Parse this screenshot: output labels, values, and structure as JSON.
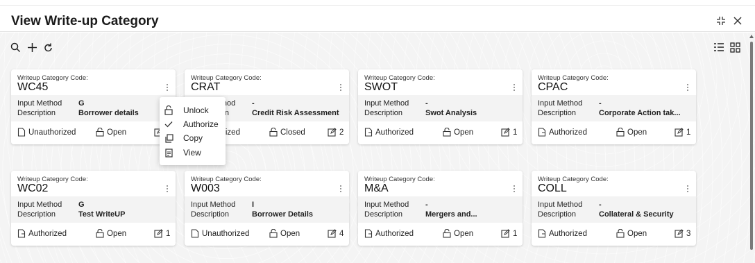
{
  "header": {
    "title": "View Write-up Category"
  },
  "toolbar": {},
  "cards": [
    {
      "code_label": "Writeup Category Code:",
      "code": "WC45",
      "input_method_label": "Input Method",
      "input_method": "G",
      "description_label": "Description",
      "description": "Borrower details",
      "status": "Unauthorized",
      "record": "Open",
      "versions": "1"
    },
    {
      "code_label": "Writeup Category Code:",
      "code": "CRAT",
      "input_method_label": "Input Method",
      "input_method": "-",
      "description_label": "Description",
      "description": "Credit Risk Assessment",
      "status": "Authorized",
      "record": "Closed",
      "versions": "2"
    },
    {
      "code_label": "Writeup Category Code:",
      "code": "SWOT",
      "input_method_label": "Input Method",
      "input_method": "-",
      "description_label": "Description",
      "description": "Swot Analysis",
      "status": "Authorized",
      "record": "Open",
      "versions": "1"
    },
    {
      "code_label": "Writeup Category Code:",
      "code": "CPAC",
      "input_method_label": "Input Method",
      "input_method": "-",
      "description_label": "Description",
      "description": "Corporate Action tak...",
      "status": "Authorized",
      "record": "Open",
      "versions": "1"
    },
    {
      "code_label": "Writeup Category Code:",
      "code": "WC02",
      "input_method_label": "Input Method",
      "input_method": "G",
      "description_label": "Description",
      "description": "Test WriteUP",
      "status": "Authorized",
      "record": "Open",
      "versions": "1"
    },
    {
      "code_label": "Writeup Category Code:",
      "code": "W003",
      "input_method_label": "Input Method",
      "input_method": "I",
      "description_label": "Description",
      "description": "Borrower Details",
      "status": "Unauthorized",
      "record": "Open",
      "versions": "4"
    },
    {
      "code_label": "Writeup Category Code:",
      "code": "M&A",
      "input_method_label": "Input Method",
      "input_method": "-",
      "description_label": "Description",
      "description": "Mergers and...",
      "status": "Authorized",
      "record": "Open",
      "versions": "1"
    },
    {
      "code_label": "Writeup Category Code:",
      "code": "COLL",
      "input_method_label": "Input Method",
      "input_method": "-",
      "description_label": "Description",
      "description": "Collateral & Security",
      "status": "Authorized",
      "record": "Open",
      "versions": "3"
    }
  ],
  "context_menu": {
    "unlock": "Unlock",
    "authorize": "Authorize",
    "copy": "Copy",
    "view": "View"
  },
  "colors": {
    "background": "#f4f4f4",
    "card": "#ffffff",
    "card_band": "#f3f3f3",
    "text": "#1f1f1f"
  }
}
